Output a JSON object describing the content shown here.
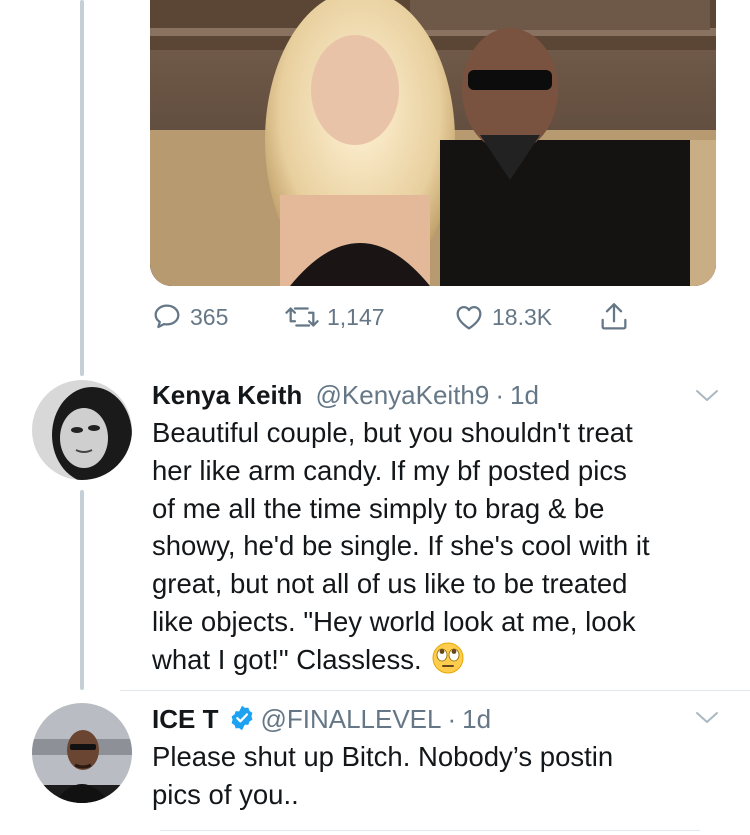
{
  "photo": {
    "icon": "couple-photo"
  },
  "actions": {
    "replies": {
      "icon": "reply-icon",
      "count": "365"
    },
    "retweets": {
      "icon": "retweet-icon",
      "count": "1,147"
    },
    "likes": {
      "icon": "heart-icon",
      "count": "18.3K"
    },
    "share": {
      "icon": "share-icon"
    }
  },
  "tweets": [
    {
      "name": "Kenya Keith",
      "handle": "@KenyaKeith9",
      "separator": "·",
      "time": "1d",
      "verified": false,
      "lines": [
        "Beautiful couple, but you shouldn't treat",
        "her like arm candy. If my bf posted pics",
        "of me all the time simply to brag & be",
        "showy, he'd be single. If she's cool with it",
        "great, but not all of us like to be treated",
        "like objects. \"Hey world look at me, look",
        "what I got!\" Classless."
      ],
      "emoji": "face-with-rolling-eyes"
    },
    {
      "name": "ICE T",
      "handle": "@FINALLEVEL",
      "separator": "·",
      "time": "1d",
      "verified": true,
      "lines": [
        "Please shut up Bitch. Nobody’s postin",
        "pics of you.."
      ]
    }
  ],
  "colors": {
    "text": "#14171a",
    "secondary": "#657786",
    "verified": "#1da1f2",
    "thread_line": "#c4cfd6"
  }
}
